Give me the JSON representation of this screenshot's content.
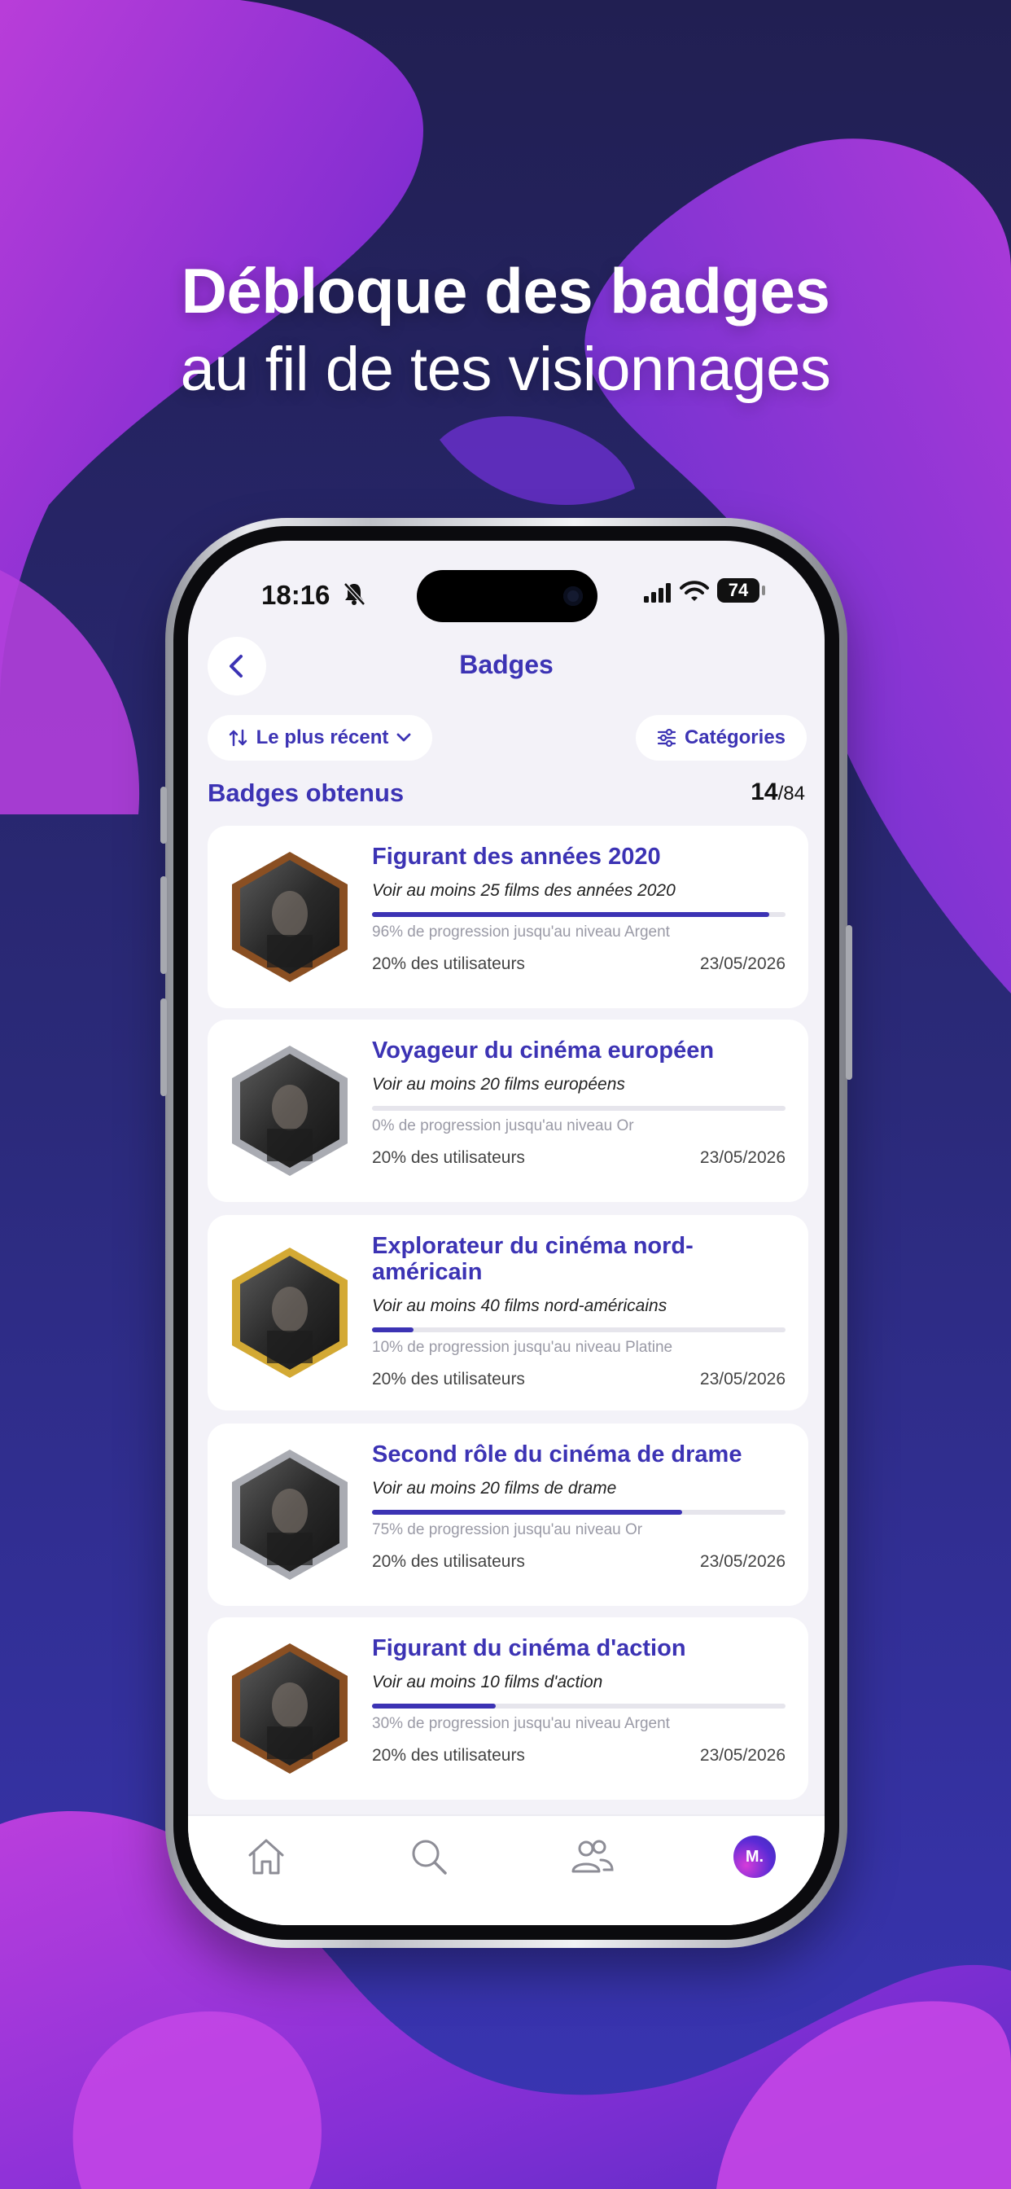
{
  "promo": {
    "headline_bold": "Débloque des badges",
    "headline_regular": "au fil de tes visionnages"
  },
  "status_bar": {
    "time": "18:16",
    "battery": "74"
  },
  "header": {
    "title": "Badges"
  },
  "filters": {
    "sort_label": "Le plus récent",
    "categories_label": "Catégories"
  },
  "section": {
    "title": "Badges obtenus",
    "count": "14",
    "total": "/84"
  },
  "badges": [
    {
      "title": "Figurant des années 2020",
      "description": "Voir au moins 25 films des années 2020",
      "progress": 0.96,
      "progress_text": "96% de progression jusqu'au niveau Argent",
      "users": "20% des utilisateurs",
      "date": "23/05/2026",
      "tier_color": "#8a4f22"
    },
    {
      "title": "Voyageur du cinéma européen",
      "description": "Voir au moins 20 films européens",
      "progress": 0.0,
      "progress_text": "0% de progression jusqu'au niveau Or",
      "users": "20% des utilisateurs",
      "date": "23/05/2026",
      "tier_color": "#a9abb2"
    },
    {
      "title": "Explorateur du cinéma nord-américain",
      "description": "Voir au moins 40 films nord-américains",
      "progress": 0.1,
      "progress_text": "10% de progression jusqu'au niveau Platine",
      "users": "20% des utilisateurs",
      "date": "23/05/2026",
      "tier_color": "#d3a934"
    },
    {
      "title": "Second rôle du cinéma de drame",
      "description": "Voir au moins 20 films de drame",
      "progress": 0.75,
      "progress_text": "75% de progression jusqu'au niveau Or",
      "users": "20% des utilisateurs",
      "date": "23/05/2026",
      "tier_color": "#a9abb2"
    },
    {
      "title": "Figurant du cinéma d'action",
      "description": "Voir au moins 10 films d'action",
      "progress": 0.3,
      "progress_text": "30% de progression jusqu'au niveau Argent",
      "users": "20% des utilisateurs",
      "date": "23/05/2026",
      "tier_color": "#8a4f22"
    }
  ],
  "tab_bar": {
    "avatar_initials": "M."
  },
  "colors": {
    "accent": "#3c33b4",
    "background": "#262668",
    "blob": "#b23fdc"
  }
}
